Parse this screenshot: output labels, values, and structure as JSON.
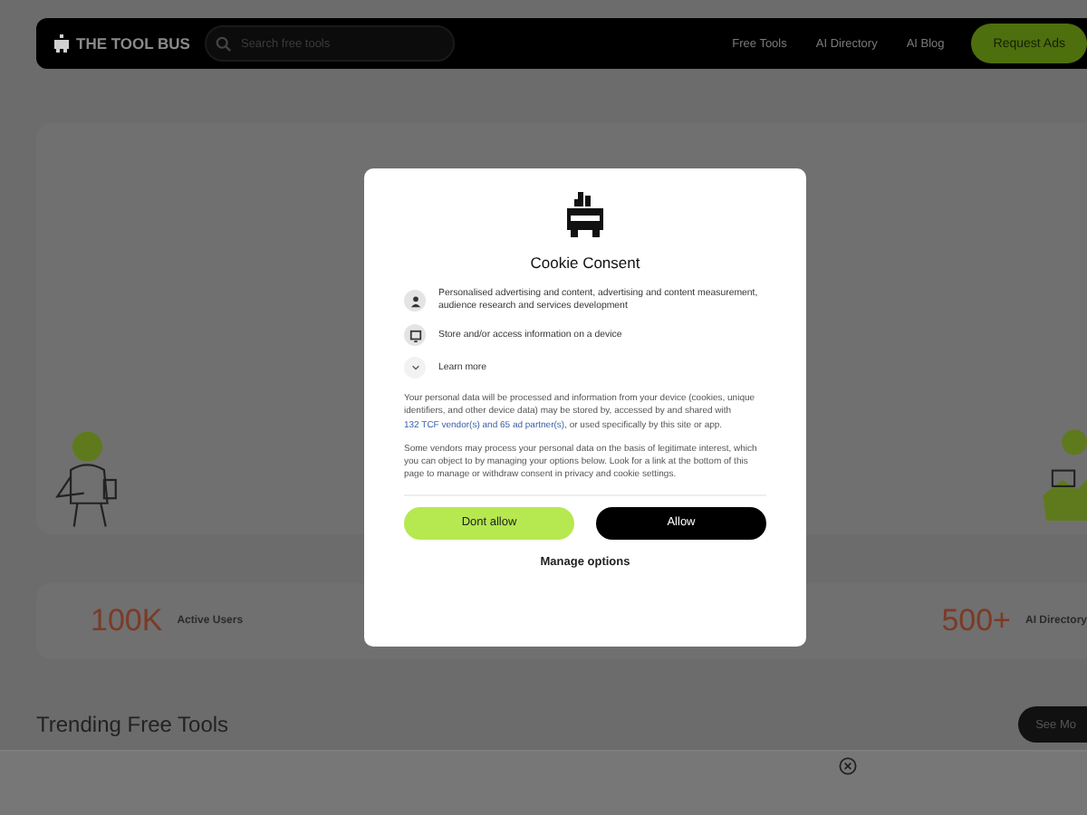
{
  "header": {
    "logo": "THE TOOL BUS",
    "search": {
      "placeholder": "Search free tools"
    },
    "nav": [
      "Free Tools",
      "AI Directory",
      "AI Blog"
    ],
    "cta": "Request Ads"
  },
  "stats": [
    {
      "value": "100K",
      "label": "Active Users"
    },
    {
      "value": "500+",
      "label": "AI Directory"
    }
  ],
  "section": {
    "title": "Trending Free Tools",
    "button": "See Mo"
  },
  "consent": {
    "title": "Cookie Consent",
    "purposes": [
      {
        "kind": "person",
        "text": "Personalised advertising and content, advertising and content measurement, audience research and services development"
      },
      {
        "kind": "device",
        "text": "Store and/or access information on a device"
      }
    ],
    "learn_more": "Learn more",
    "paragraph_1": {
      "before": "Your personal data will be processed and information from your device (cookies, unique identifiers, and other device data) may be stored by, accessed by and shared with ",
      "link": "132 TCF vendor(s) and 65 ad partner(s)",
      "after": ", or used specifically by this site or app."
    },
    "paragraph_2": "Some vendors may process your personal data on the basis of legitimate interest, which you can object to by managing your options below. Look for a link at the bottom of this page to manage or withdraw consent in privacy and cookie settings.",
    "buttons": [
      {
        "kind": "decline",
        "label": "Dont allow"
      },
      {
        "kind": "accept",
        "label": "Allow"
      }
    ],
    "manage": "Manage options"
  }
}
